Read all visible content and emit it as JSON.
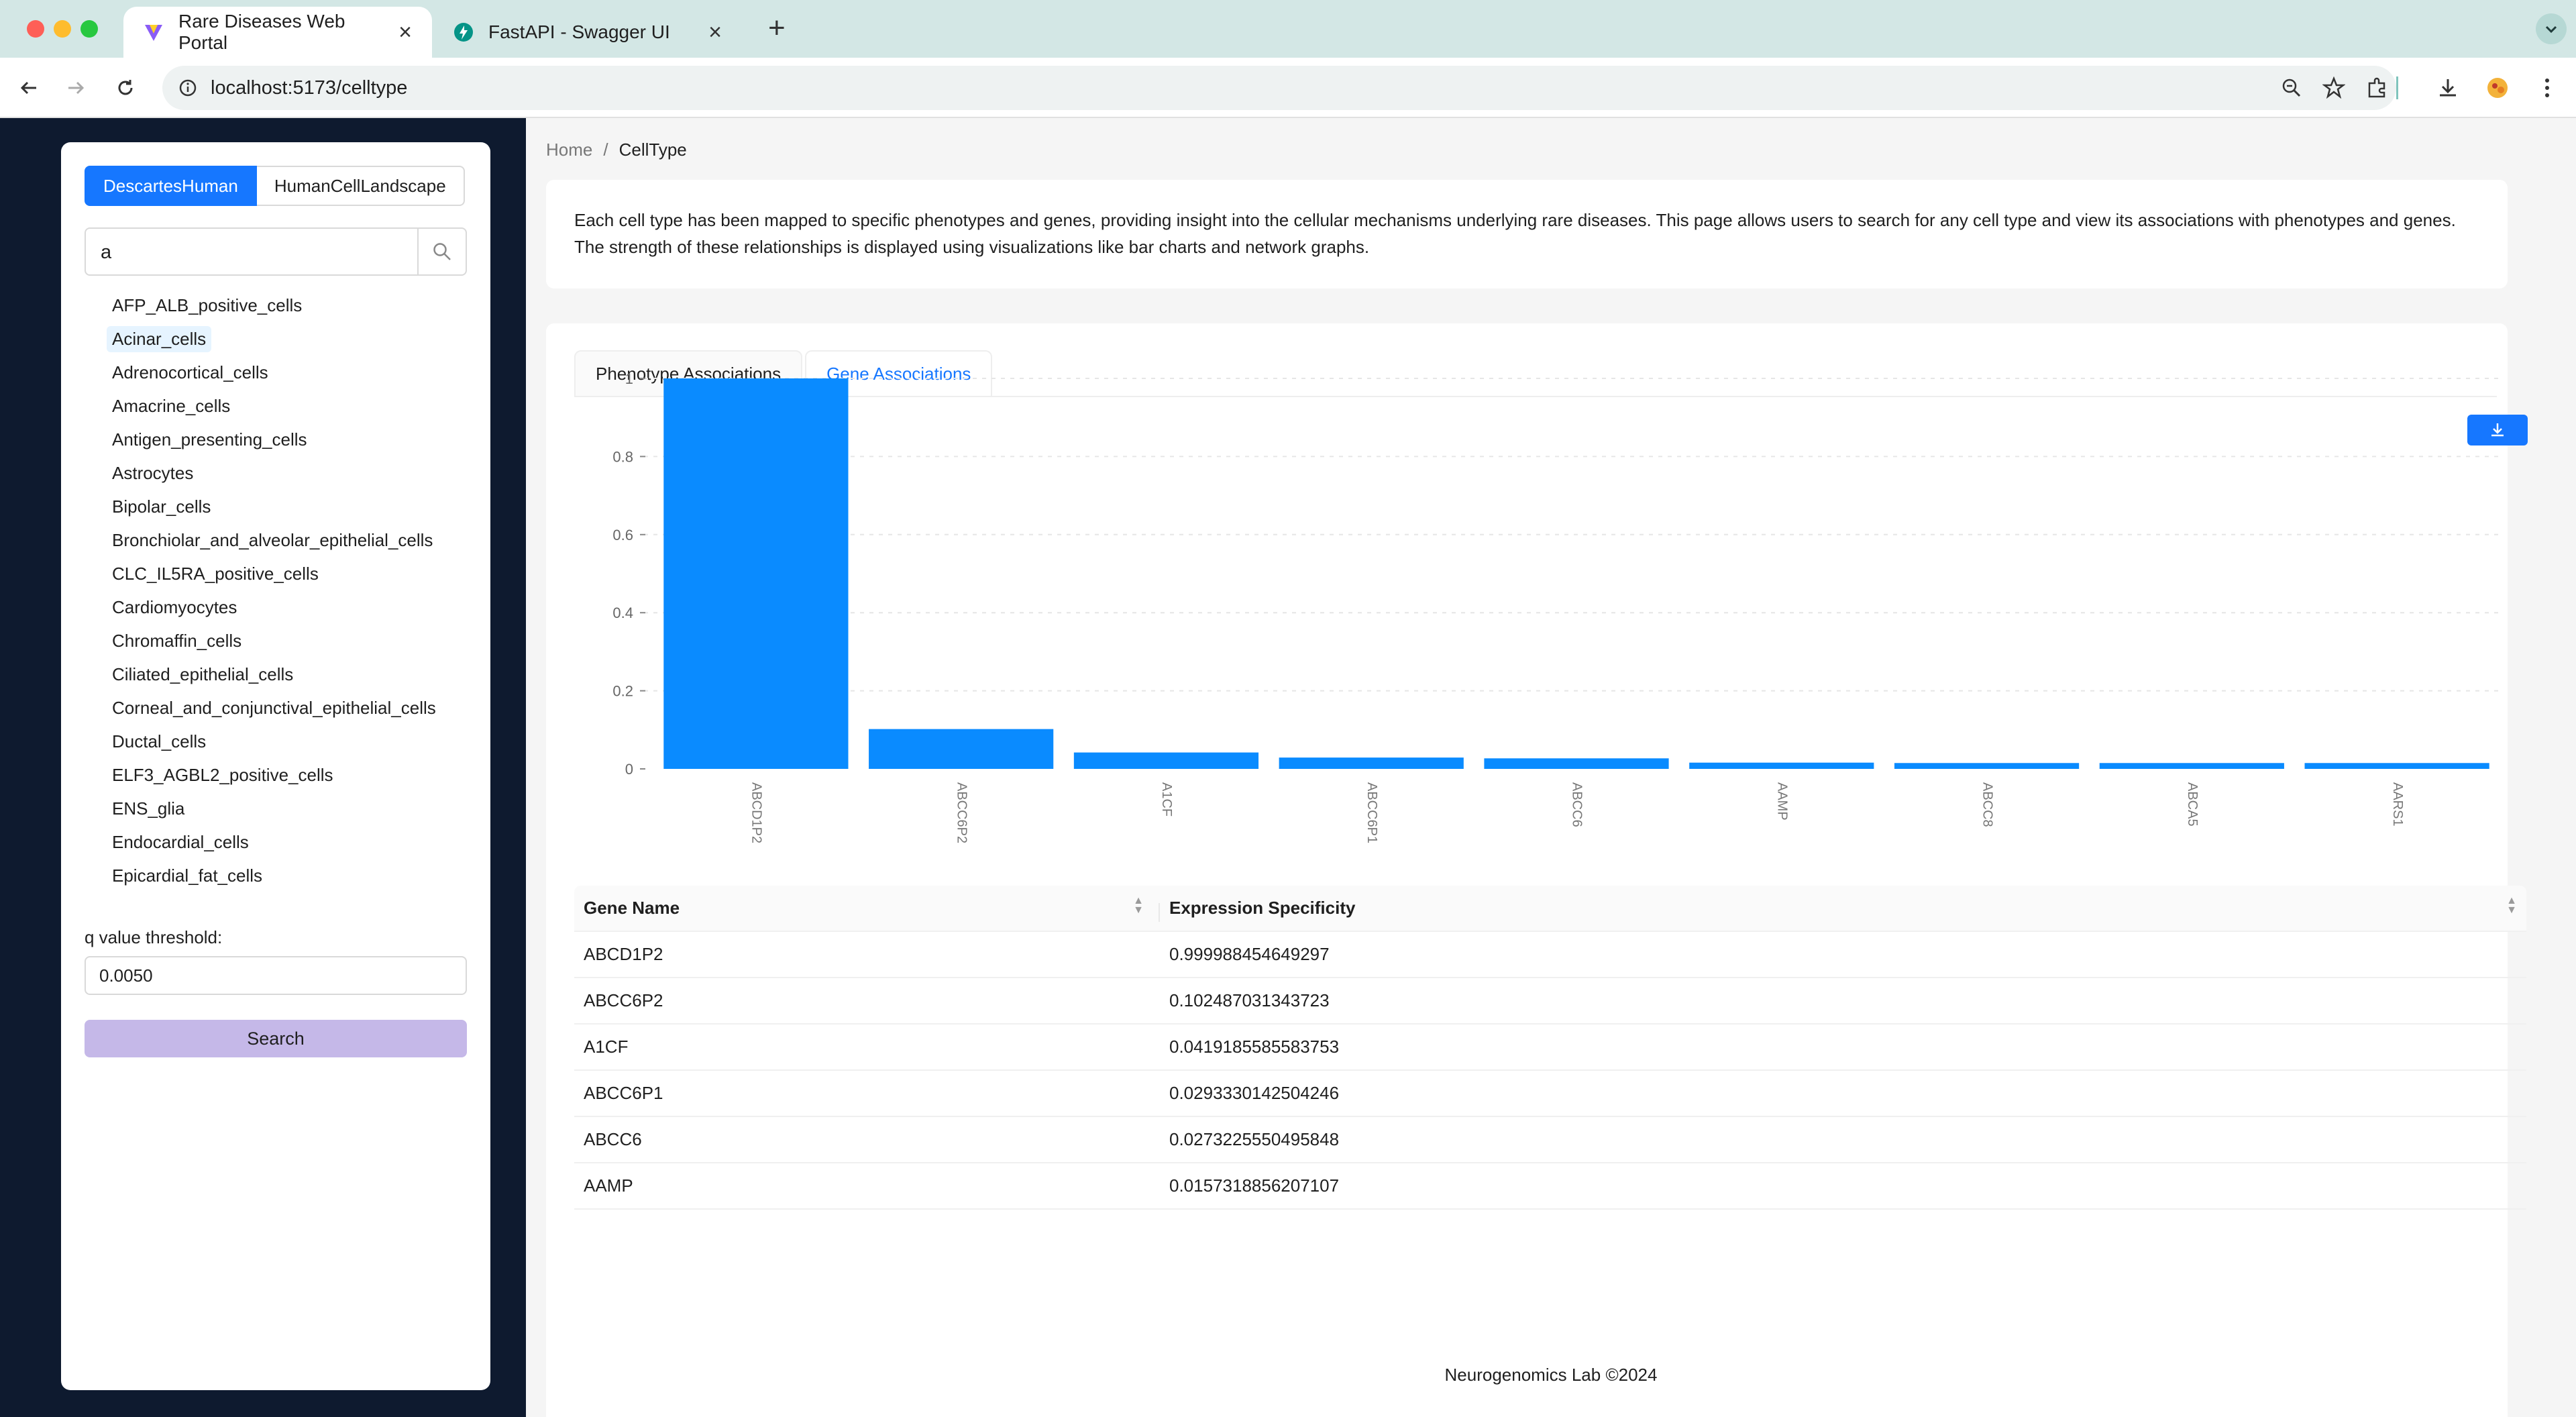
{
  "browser": {
    "tabs": [
      {
        "title": "Rare Diseases Web Portal",
        "active": true
      },
      {
        "title": "FastAPI - Swagger UI",
        "active": false
      }
    ],
    "url": "localhost:5173/celltype"
  },
  "sidebar": {
    "datasets": [
      "DescartesHuman",
      "HumanCellLandscape"
    ],
    "selected_dataset": "DescartesHuman",
    "search_value": "a",
    "cell_types": [
      "AFP_ALB_positive_cells",
      "Acinar_cells",
      "Adrenocortical_cells",
      "Amacrine_cells",
      "Antigen_presenting_cells",
      "Astrocytes",
      "Bipolar_cells",
      "Bronchiolar_and_alveolar_epithelial_cells",
      "CLC_IL5RA_positive_cells",
      "Cardiomyocytes",
      "Chromaffin_cells",
      "Ciliated_epithelial_cells",
      "Corneal_and_conjunctival_epithelial_cells",
      "Ductal_cells",
      "ELF3_AGBL2_positive_cells",
      "ENS_glia",
      "Endocardial_cells",
      "Epicardial_fat_cells"
    ],
    "selected_cell_type": "Acinar_cells",
    "q_label": "q value threshold:",
    "q_value": "0.0050",
    "search_button": "Search"
  },
  "breadcrumb": {
    "home": "Home",
    "sep": "/",
    "current": "CellType"
  },
  "intro": "Each cell type has been mapped to specific phenotypes and genes, providing insight into the cellular mechanisms underlying rare diseases. This page allows users to search for any cell type and view its associations with phenotypes and genes. The strength of these relationships is displayed using visualizations like bar charts and network graphs.",
  "tabs": [
    "Phenotype Associations",
    "Gene Associations"
  ],
  "active_tab": "Gene Associations",
  "chart_data": {
    "type": "bar",
    "categories": [
      "ABCD1P2",
      "ABCC6P2",
      "A1CF",
      "ABCC6P1",
      "ABCC6",
      "AAMP",
      "ABCC8",
      "ABCA5",
      "AARS1"
    ],
    "values": [
      1.0,
      0.102,
      0.042,
      0.029,
      0.027,
      0.016,
      0.015,
      0.015,
      0.015
    ],
    "yticks": [
      "0",
      "0.2",
      "0.4",
      "0.6",
      "0.8",
      "1"
    ],
    "ylim": [
      0,
      1
    ],
    "grid": true,
    "bar_color": "#0a8bff",
    "slider": {
      "start_label": "ABCD1P2",
      "end_label": "AARS1"
    }
  },
  "table": {
    "headers": [
      "Gene Name",
      "Expression Specificity"
    ],
    "rows": [
      [
        "ABCD1P2",
        "0.999988454649297"
      ],
      [
        "ABCC6P2",
        "0.102487031343723"
      ],
      [
        "A1CF",
        "0.0419185585583753"
      ],
      [
        "ABCC6P1",
        "0.0293330142504246"
      ],
      [
        "ABCC6",
        "0.0273225550495848"
      ],
      [
        "AAMP",
        "0.0157318856207107"
      ]
    ]
  },
  "footer": "Neurogenomics Lab ©2024",
  "colors": {
    "primary": "#1677ff",
    "sider": "#0e1a2f",
    "search_button": "#c5b8e8"
  }
}
